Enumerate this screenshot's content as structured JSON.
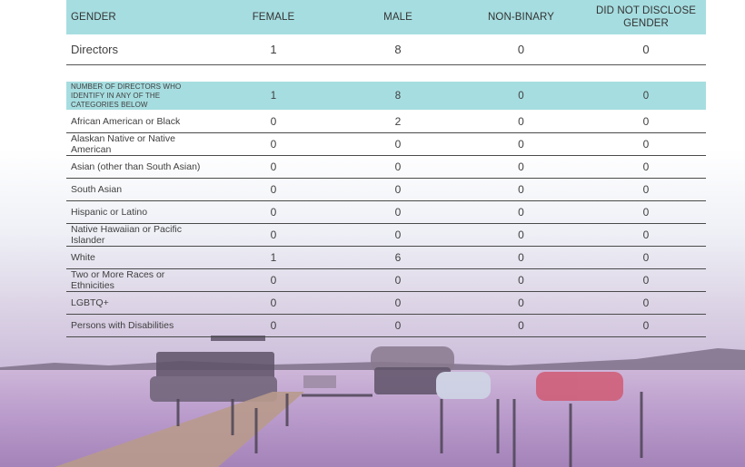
{
  "table": {
    "headers": [
      "GENDER",
      "FEMALE",
      "MALE",
      "NON-BINARY",
      "DID NOT DISCLOSE GENDER"
    ],
    "directors": {
      "label": "Directors",
      "values": [
        "1",
        "8",
        "0",
        "0"
      ]
    },
    "subheader": {
      "label": "NUMBER OF DIRECTORS WHO IDENTIFY IN ANY OF THE CATEGORIES BELOW",
      "values": [
        "1",
        "8",
        "0",
        "0"
      ]
    },
    "rows": [
      {
        "label": "African American or Black",
        "values": [
          "0",
          "2",
          "0",
          "0"
        ]
      },
      {
        "label": "Alaskan Native or Native American",
        "values": [
          "0",
          "0",
          "0",
          "0"
        ]
      },
      {
        "label": "Asian (other than South Asian)",
        "values": [
          "0",
          "0",
          "0",
          "0"
        ]
      },
      {
        "label": "South Asian",
        "values": [
          "0",
          "0",
          "0",
          "0"
        ]
      },
      {
        "label": "Hispanic or Latino",
        "values": [
          "0",
          "0",
          "0",
          "0"
        ]
      },
      {
        "label": "Native Hawaiian or Pacific Islander",
        "values": [
          "0",
          "0",
          "0",
          "0"
        ]
      },
      {
        "label": "White",
        "values": [
          "1",
          "6",
          "0",
          "0"
        ]
      },
      {
        "label": "Two or More Races or Ethnicities",
        "values": [
          "0",
          "0",
          "0",
          "0"
        ]
      },
      {
        "label": "LGBTQ+",
        "values": [
          "0",
          "0",
          "0",
          "0"
        ]
      },
      {
        "label": "Persons with Disabilities",
        "values": [
          "0",
          "0",
          "0",
          "0"
        ]
      }
    ]
  }
}
